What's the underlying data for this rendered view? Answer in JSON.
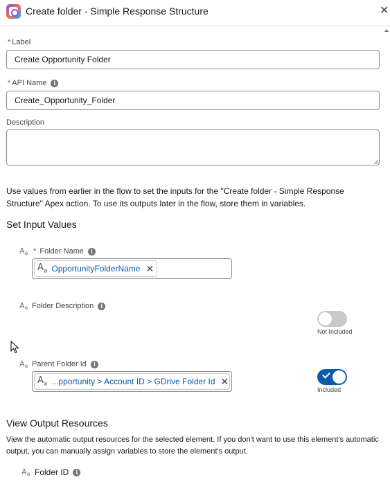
{
  "header": {
    "title": "Create folder - Simple Response Structure",
    "app_icon": "flow-builder-icon",
    "close_icon": "close-icon"
  },
  "label_field": {
    "required_mark": "*",
    "label": "Label",
    "value": "Create Opportunity Folder"
  },
  "api_name_field": {
    "required_mark": "*",
    "label": "API Name",
    "info_icon": "i",
    "value": "Create_Opportunity_Folder"
  },
  "description_field": {
    "label": "Description",
    "value": ""
  },
  "intro_text": "Use values from earlier in the flow to set the inputs for the \"Create folder - Simple Response Structure\" Apex action. To use its outputs later in the flow, store them in variables.",
  "input_section": {
    "title": "Set Input Values",
    "folder_name": {
      "type_glyph": "A",
      "type_glyph_sub": "a",
      "required_mark": "*",
      "label": "Folder Name",
      "info_icon": "i",
      "pill_text": "OpportunityFolderName",
      "pill_remove": "✕"
    },
    "folder_description": {
      "type_glyph": "A",
      "type_glyph_sub": "a",
      "label": "Folder Description",
      "info_icon": "i",
      "toggle_caption": "Not Included",
      "included": false
    },
    "parent_folder_id": {
      "type_glyph": "A",
      "type_glyph_sub": "a",
      "label": "Parent Folder Id",
      "info_icon": "i",
      "pill_text": "...pportunity > Account ID > GDrive Folder Id",
      "pill_remove": "✕",
      "toggle_caption": "Included",
      "included": true
    }
  },
  "output_section": {
    "title": "View Output Resources",
    "description": "View the automatic output resources for the selected element. If you don't want to use this element's automatic output, you can manually assign variables to store the element's output.",
    "folder_id": {
      "type_glyph": "A",
      "type_glyph_sub": "a",
      "label": "Folder ID",
      "info_icon": "i"
    }
  },
  "colors": {
    "accent": "#0b5cab",
    "required": "#c23934",
    "toggle_off": "#c9c9c9",
    "border": "#8c8c8c"
  }
}
